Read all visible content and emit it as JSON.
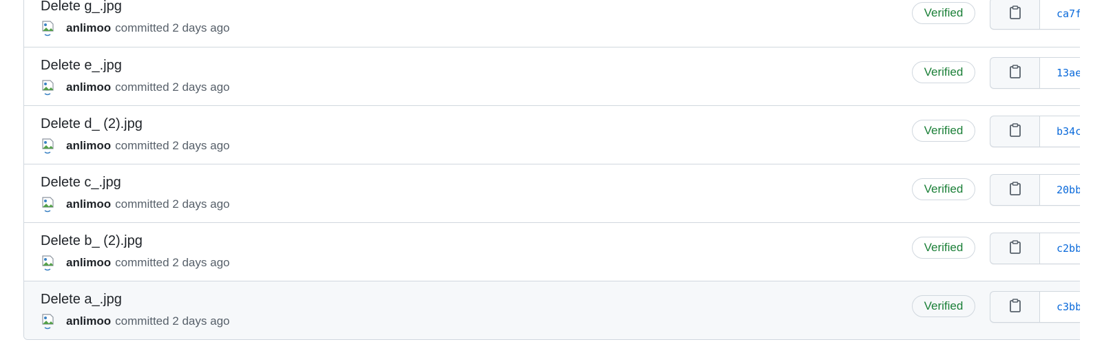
{
  "commits": [
    {
      "title": "Delete g_.jpg",
      "author": "anlimoo",
      "time": "committed 2 days ago",
      "verified": "Verified",
      "sha": "ca7f"
    },
    {
      "title": "Delete e_.jpg",
      "author": "anlimoo",
      "time": "committed 2 days ago",
      "verified": "Verified",
      "sha": "13ae"
    },
    {
      "title": "Delete d_ (2).jpg",
      "author": "anlimoo",
      "time": "committed 2 days ago",
      "verified": "Verified",
      "sha": "b34c"
    },
    {
      "title": "Delete c_.jpg",
      "author": "anlimoo",
      "time": "committed 2 days ago",
      "verified": "Verified",
      "sha": "20bb"
    },
    {
      "title": "Delete b_ (2).jpg",
      "author": "anlimoo",
      "time": "committed 2 days ago",
      "verified": "Verified",
      "sha": "c2bb"
    },
    {
      "title": "Delete a_.jpg",
      "author": "anlimoo",
      "time": "committed 2 days ago",
      "verified": "Verified",
      "sha": "c3bb"
    }
  ],
  "icons": {
    "avatar": "broken-image-avatar-icon",
    "copy": "clipboard-icon"
  },
  "colors": {
    "verified": "#1a7f37",
    "sha_link": "#0969da",
    "border": "#d0d7de",
    "hover_row": "#f6f8fa"
  }
}
